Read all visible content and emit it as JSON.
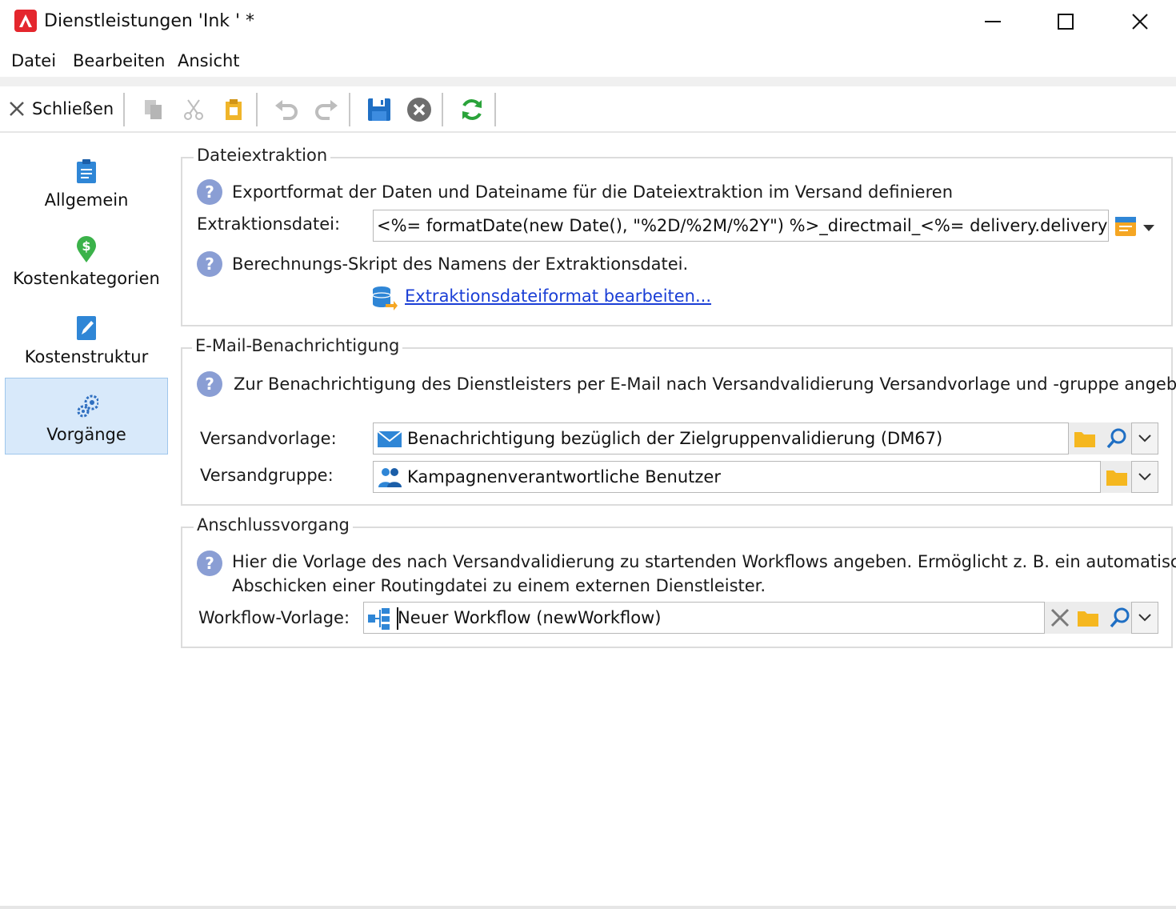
{
  "window": {
    "title": "Dienstleistungen 'Ink ' *"
  },
  "menu": {
    "items": [
      "Datei",
      "Bearbeiten",
      "Ansicht"
    ]
  },
  "toolbar": {
    "close_label": "Schließen"
  },
  "sidebar": {
    "items": [
      {
        "label": "Allgemein",
        "icon": "clipboard-icon"
      },
      {
        "label": "Kostenkategorien",
        "icon": "money-pin-icon"
      },
      {
        "label": "Kostenstruktur",
        "icon": "edit-doc-icon"
      },
      {
        "label": "Vorgänge",
        "icon": "gears-icon",
        "active": true
      }
    ]
  },
  "file_extraction": {
    "title": "Dateiextraktion",
    "help_text": "Exportformat der Daten und Dateiname für die Dateiextraktion im Versand definieren",
    "field_label": "Extraktionsdatei:",
    "field_value": "<%= formatDate(new Date(), \"%2D/%2M/%2Y\") %>_directmail_<%= delivery.deliveryCode %>",
    "script_help": "Berechnungs-Skript des Namens der Extraktionsdatei.",
    "link_label": "Extraktionsdateiformat bearbeiten..."
  },
  "email_notification": {
    "title": "E-Mail-Benachrichtigung",
    "help_text": "Zur Benachrichtigung des Dienstleisters per E-Mail nach Versandvalidierung Versandvorlage und -gruppe angeben.",
    "template_label": "Versandvorlage:",
    "template_value": "Benachrichtigung bezüglich der Zielgruppenvalidierung (DM67)",
    "group_label": "Versandgruppe:",
    "group_value": "Kampagnenverantwortliche Benutzer"
  },
  "follow_up": {
    "title": "Anschlussvorgang",
    "help_line1": "Hier die Vorlage des nach Versandvalidierung zu startenden Workflows angeben. Ermöglicht z. B. ein automatisches",
    "help_line2": "Abschicken einer Routingdatei zu einem externen Dienstleister.",
    "workflow_label": "Workflow-Vorlage:",
    "workflow_value": "Neuer Workflow (newWorkflow)"
  },
  "colors": {
    "accent": "#1b3fd6",
    "active_bg": "#d8e9fa",
    "help_icon": "#8a9ed4",
    "brand_red": "#e4262d"
  }
}
